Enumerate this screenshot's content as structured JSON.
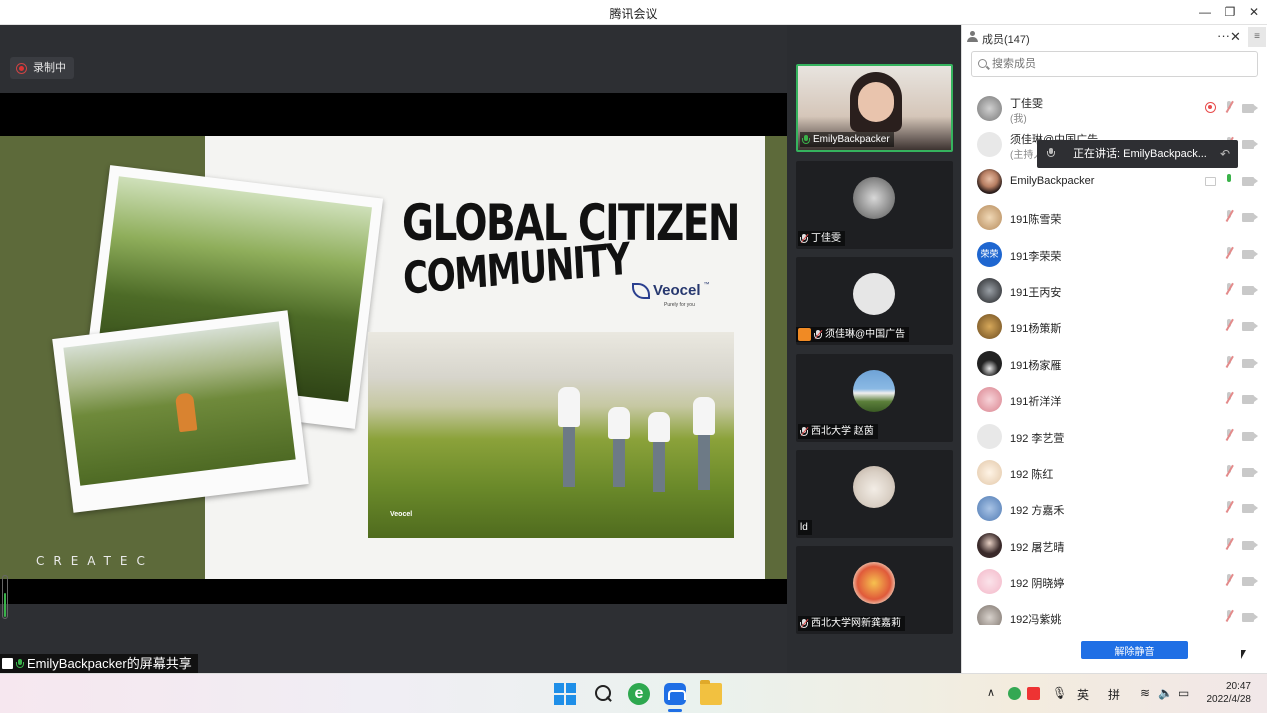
{
  "window": {
    "title": "腾讯会议"
  },
  "recording": {
    "label": "录制中"
  },
  "slide": {
    "title_line1": "GLOBAL CITIZEN",
    "title_line2": "COMMUNITY",
    "brand": "Veocel",
    "brand_tm": "™",
    "brand_tagline": "Purely for you",
    "photo_watermark": "Veocel",
    "footer_logo": "CREATEC"
  },
  "share": {
    "label": "EmilyBackpacker的屏幕共享"
  },
  "videos": [
    {
      "name": "EmilyBackpacker",
      "speaking": true
    },
    {
      "name": "丁佳雯"
    },
    {
      "name": "须佳琳@中国广告",
      "host": true
    },
    {
      "name": "西北大学 赵茵"
    },
    {
      "name": "ld"
    },
    {
      "name": "西北大学网新龚嘉莉"
    }
  ],
  "panel": {
    "title": "成员(147)",
    "more": "···",
    "close": "✕",
    "side_toggle": "≡",
    "search_placeholder": "搜索成员",
    "speaking_tip": "正在讲话: EmilyBackpack...",
    "members": [
      {
        "name": "丁佳雯",
        "sub": "(我)",
        "rec": true
      },
      {
        "name": "须佳琳@中国广告",
        "sub": "(主持人)"
      },
      {
        "name": "EmilyBackpacker",
        "screen": true,
        "mic_on": true
      },
      {
        "name": "191陈雪荣"
      },
      {
        "name": "191李荣荣",
        "avatar_text": "荣荣"
      },
      {
        "name": "191王丙安"
      },
      {
        "name": "191杨策斯"
      },
      {
        "name": "191杨家雁"
      },
      {
        "name": "191祈洋洋"
      },
      {
        "name": "192  李艺萱"
      },
      {
        "name": "192 陈红"
      },
      {
        "name": "192 方嘉禾"
      },
      {
        "name": "192 屠艺晴"
      },
      {
        "name": "192 阴晓婷"
      },
      {
        "name": "192冯紫姚"
      }
    ],
    "unmute_all": "解除静音"
  },
  "taskbar": {
    "ime_lang": "英",
    "ime_mode": "拼",
    "time": "20:47",
    "date": "2022/4/28"
  },
  "colors": {
    "accent": "#1f6fe5",
    "speaking": "#35b35e",
    "slide_green": "#5d6a3a",
    "record": "#e84b4b"
  }
}
